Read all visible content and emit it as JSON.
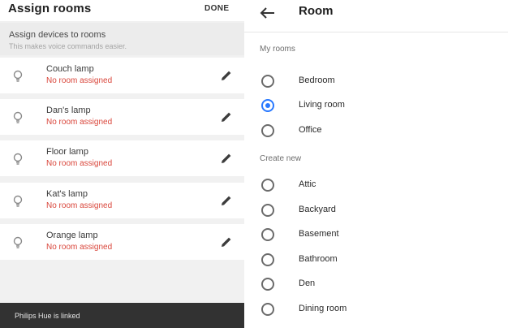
{
  "left_panel": {
    "title": "Assign rooms",
    "done_label": "DONE",
    "hint": {
      "title": "Assign devices to rooms",
      "subtitle": "This makes voice commands easier."
    },
    "devices": [
      {
        "name": "Couch lamp",
        "status": "No room assigned",
        "icon": "lightbulb-icon"
      },
      {
        "name": "Dan's lamp",
        "status": "No room assigned",
        "icon": "lightbulb-icon"
      },
      {
        "name": "Floor lamp",
        "status": "No room assigned",
        "icon": "lightbulb-icon"
      },
      {
        "name": "Kat's lamp",
        "status": "No room assigned",
        "icon": "lightbulb-icon"
      },
      {
        "name": "Orange lamp",
        "status": "No room assigned",
        "icon": "lightbulb-icon"
      }
    ],
    "snackbar": "Philips Hue is linked"
  },
  "right_panel": {
    "title": "Room",
    "back_icon": "arrow-back-icon",
    "my_rooms_label": "My rooms",
    "my_rooms": [
      {
        "label": "Bedroom",
        "checked": false
      },
      {
        "label": "Living room",
        "checked": true
      },
      {
        "label": "Office",
        "checked": false
      }
    ],
    "create_new_label": "Create new",
    "create_new": [
      {
        "label": "Attic",
        "checked": false
      },
      {
        "label": "Backyard",
        "checked": false
      },
      {
        "label": "Basement",
        "checked": false
      },
      {
        "label": "Bathroom",
        "checked": false
      },
      {
        "label": "Den",
        "checked": false
      },
      {
        "label": "Dining room",
        "checked": false
      }
    ]
  },
  "colors": {
    "accent": "#2979ff",
    "status_error": "#d9453a",
    "snackbar_bg": "#323232"
  }
}
